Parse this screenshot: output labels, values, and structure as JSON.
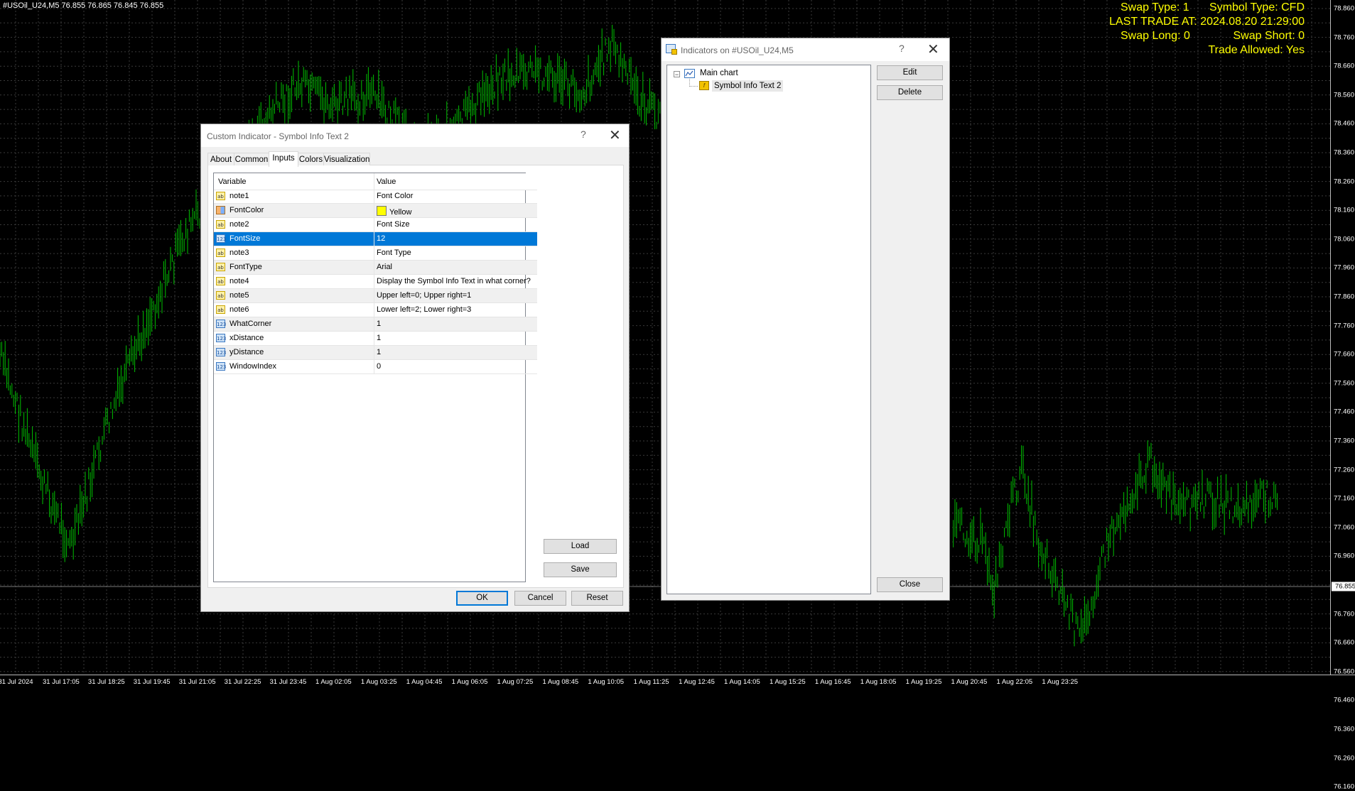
{
  "chart": {
    "header": "#USOil_U24,M5  76.855 76.865 76.845 76.855",
    "info": {
      "swap_type": "Swap Type: 1",
      "symbol_type": "Symbol Type: CFD",
      "last_trade": "LAST TRADE AT: 2024.08.20 21:29:00",
      "swap_long": "Swap Long: 0",
      "swap_short": "Swap Short: 0",
      "trade_allowed": "Trade Allowed: Yes"
    },
    "line_color": "#00c000",
    "grid_color": "#3a3a3a",
    "price_labels": [
      "78.860",
      "78.760",
      "78.660",
      "78.560",
      "78.460",
      "78.360",
      "78.260",
      "78.160",
      "78.060",
      "77.960",
      "77.860",
      "77.760",
      "77.660",
      "77.560",
      "77.460",
      "77.360",
      "77.260",
      "77.160",
      "77.060",
      "76.960",
      "76.760",
      "76.660",
      "76.560",
      "76.460",
      "76.360",
      "76.260",
      "76.160"
    ],
    "current_price": "76.855",
    "time_labels": [
      "31 Jul 2024",
      "31 Jul 17:05",
      "31 Jul 18:25",
      "31 Jul 19:45",
      "31 Jul 21:05",
      "31 Jul 22:25",
      "31 Jul 23:45",
      "1 Aug 02:05",
      "1 Aug 03:25",
      "1 Aug 04:45",
      "1 Aug 06:05",
      "1 Aug 07:25",
      "1 Aug 08:45",
      "1 Aug 10:05",
      "1 Aug 11:25",
      "1 Aug 12:45",
      "1 Aug 14:05",
      "1 Aug 15:25",
      "1 Aug 16:45",
      "1 Aug 18:05",
      "1 Aug 19:25",
      "1 Aug 20:45",
      "1 Aug 22:05",
      "1 Aug 23:25"
    ]
  },
  "custom_indicator_dialog": {
    "title": "Custom Indicator - Symbol Info Text 2",
    "help": "?",
    "close": "✕",
    "tabs": [
      "About",
      "Common",
      "Inputs",
      "Colors",
      "Visualization"
    ],
    "active_tab": "Inputs",
    "columns": {
      "variable": "Variable",
      "value": "Value"
    },
    "rows": [
      {
        "var": "note1",
        "val": "Font Color",
        "type": "ab"
      },
      {
        "var": "FontColor",
        "val": "Yellow",
        "type": "color"
      },
      {
        "var": "note2",
        "val": "Font Size",
        "type": "ab"
      },
      {
        "var": "FontSize",
        "val": "12",
        "type": "num"
      },
      {
        "var": "note3",
        "val": "Font Type",
        "type": "ab"
      },
      {
        "var": "FontType",
        "val": "Arial",
        "type": "ab"
      },
      {
        "var": "note4",
        "val": "Display the Symbol Info Text in what corner?",
        "type": "ab"
      },
      {
        "var": "note5",
        "val": "Upper left=0; Upper right=1",
        "type": "ab"
      },
      {
        "var": "note6",
        "val": "Lower left=2; Lower right=3",
        "type": "ab"
      },
      {
        "var": "WhatCorner",
        "val": "1",
        "type": "num"
      },
      {
        "var": "xDistance",
        "val": "1",
        "type": "num"
      },
      {
        "var": "yDistance",
        "val": "1",
        "type": "num"
      },
      {
        "var": "WindowIndex",
        "val": "0",
        "type": "num"
      }
    ],
    "buttons": {
      "load": "Load",
      "save": "Save",
      "ok": "OK",
      "cancel": "Cancel",
      "reset": "Reset"
    }
  },
  "indicators_dialog": {
    "title": "Indicators on #USOil_U24,M5",
    "help": "?",
    "close": "✕",
    "tree": {
      "root": "Main chart",
      "child": "Symbol Info Text 2"
    },
    "buttons": {
      "edit": "Edit",
      "delete": "Delete",
      "close": "Close"
    }
  }
}
